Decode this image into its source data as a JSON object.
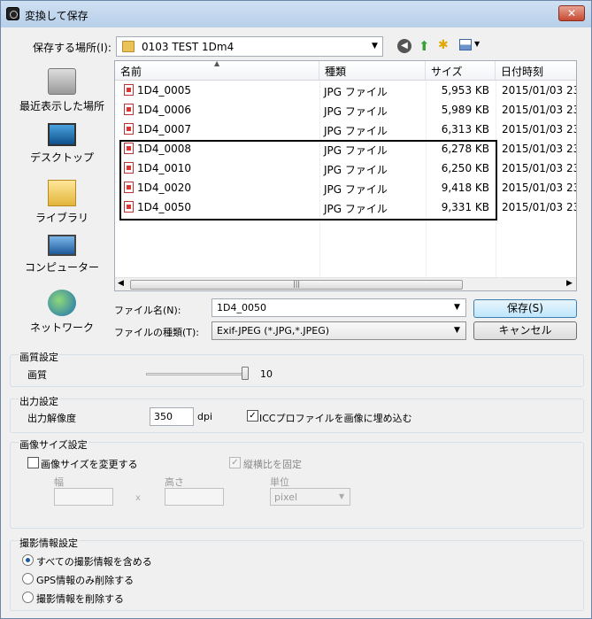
{
  "window": {
    "title": "変換して保存",
    "close_label": "✕"
  },
  "location": {
    "label": "保存する場所(I):",
    "value": "0103 TEST  1Dm4"
  },
  "places": [
    {
      "label": "最近表示した場所"
    },
    {
      "label": "デスクトップ"
    },
    {
      "label": "ライブラリ"
    },
    {
      "label": "コンピューター"
    },
    {
      "label": "ネットワーク"
    }
  ],
  "filelist": {
    "headers": {
      "name": "名前",
      "type": "種類",
      "size": "サイズ",
      "date": "日付時刻"
    },
    "rows": [
      {
        "name": "1D4_0005",
        "type": "JPG ファイル",
        "size": "5,953 KB",
        "date": "2015/01/03 23:"
      },
      {
        "name": "1D4_0006",
        "type": "JPG ファイル",
        "size": "5,989 KB",
        "date": "2015/01/03 23:"
      },
      {
        "name": "1D4_0007",
        "type": "JPG ファイル",
        "size": "6,313 KB",
        "date": "2015/01/03 23:"
      },
      {
        "name": "1D4_0008",
        "type": "JPG ファイル",
        "size": "6,278 KB",
        "date": "2015/01/03 23:"
      },
      {
        "name": "1D4_0010",
        "type": "JPG ファイル",
        "size": "6,250 KB",
        "date": "2015/01/03 23:"
      },
      {
        "name": "1D4_0020",
        "type": "JPG ファイル",
        "size": "9,418 KB",
        "date": "2015/01/03 23:"
      },
      {
        "name": "1D4_0050",
        "type": "JPG ファイル",
        "size": "9,331 KB",
        "date": "2015/01/03 23:"
      }
    ]
  },
  "filename": {
    "label": "ファイル名(N):",
    "value": "1D4_0050"
  },
  "filetype": {
    "label": "ファイルの種類(T):",
    "value": "Exif-JPEG (*.JPG,*.JPEG)"
  },
  "buttons": {
    "save": "保存(S)",
    "cancel": "キャンセル"
  },
  "quality": {
    "title": "画質設定",
    "label": "画質",
    "value": "10"
  },
  "output": {
    "title": "出力設定",
    "resolution_label": "出力解像度",
    "resolution_value": "350",
    "unit": "dpi",
    "icc_label": "ICCプロファイルを画像に埋め込む",
    "icc_checked": true
  },
  "image_size": {
    "title": "画像サイズ設定",
    "resize_label": "画像サイズを変更する",
    "aspect_label": "縦横比を固定",
    "width_label": "幅",
    "height_label": "高さ",
    "x_label": "x",
    "unit_label": "単位",
    "unit_value": "pixel"
  },
  "shooting_info": {
    "title": "撮影情報設定",
    "options": [
      {
        "label": "すべての撮影情報を含める",
        "selected": true
      },
      {
        "label": "GPS情報のみ削除する",
        "selected": false
      },
      {
        "label": "撮影情報を削除する",
        "selected": false
      }
    ]
  }
}
